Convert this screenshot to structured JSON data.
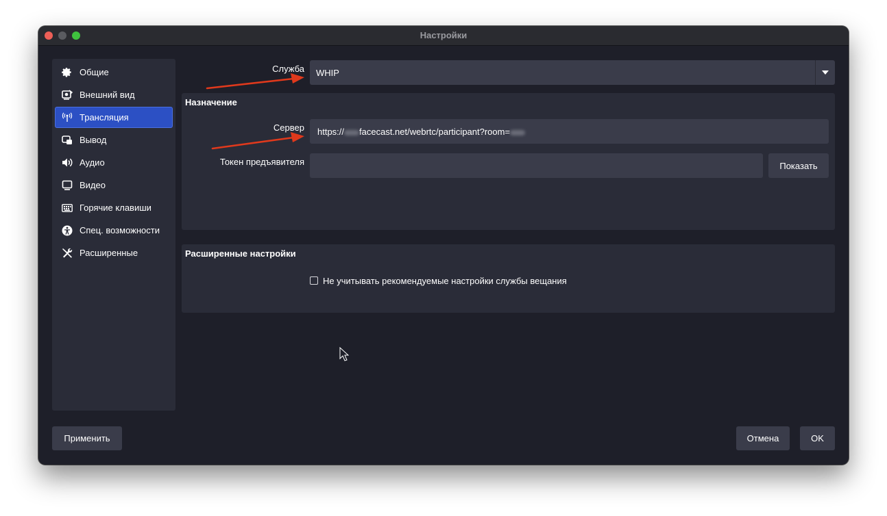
{
  "window": {
    "title": "Настройки"
  },
  "sidebar": {
    "items": [
      {
        "label": "Общие",
        "icon": "gear-icon"
      },
      {
        "label": "Внешний вид",
        "icon": "appearance-icon"
      },
      {
        "label": "Трансляция",
        "icon": "broadcast-antenna-icon",
        "active": true
      },
      {
        "label": "Вывод",
        "icon": "output-icon"
      },
      {
        "label": "Аудио",
        "icon": "speaker-icon"
      },
      {
        "label": "Видео",
        "icon": "monitor-icon"
      },
      {
        "label": "Горячие клавиши",
        "icon": "keyboard-icon"
      },
      {
        "label": "Спец. возможности",
        "icon": "accessibility-icon"
      },
      {
        "label": "Расширенные",
        "icon": "tools-icon"
      }
    ]
  },
  "service": {
    "label": "Служба",
    "value": "WHIP"
  },
  "destination": {
    "title": "Назначение",
    "server_label": "Сервер",
    "server_prefix": "https://",
    "server_middle": "facecast.net/webrtc/participant?room=",
    "token_label": "Токен предъявителя",
    "token_value": "",
    "show_button": "Показать"
  },
  "advanced": {
    "title": "Расширенные настройки",
    "ignore_recommended_label": "Не учитывать рекомендуемые настройки службы вещания",
    "ignore_recommended_checked": false
  },
  "footer": {
    "apply": "Применить",
    "cancel": "Отмена",
    "ok": "OK"
  },
  "colors": {
    "accent": "#2c50c4",
    "annotation_arrow": "#e0391c"
  }
}
